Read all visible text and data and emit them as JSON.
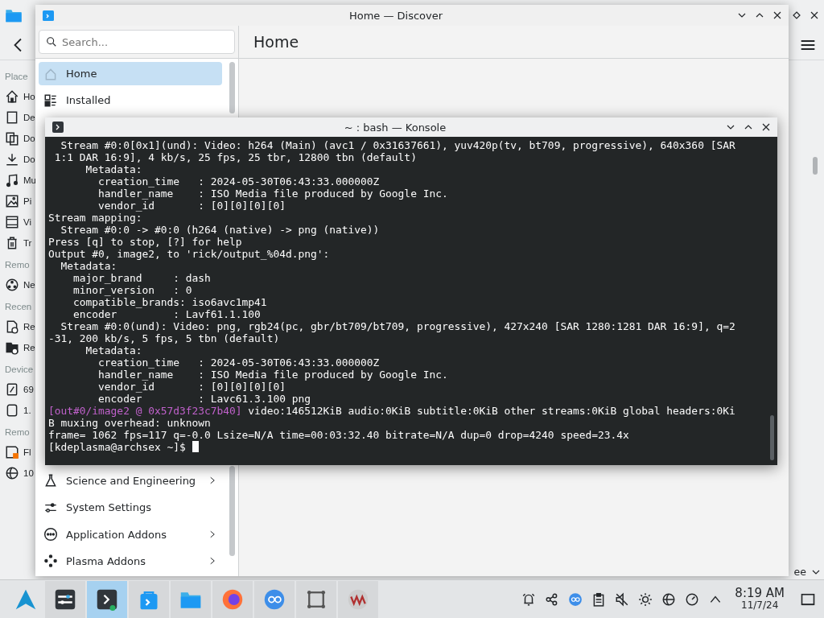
{
  "file_manager": {
    "places": [
      {
        "kind": "header",
        "label": "Place"
      },
      {
        "kind": "item",
        "label": "Ho"
      },
      {
        "kind": "item",
        "label": "De"
      },
      {
        "kind": "item",
        "label": "Do"
      },
      {
        "kind": "item",
        "label": "Do"
      },
      {
        "kind": "item",
        "label": "Mu"
      },
      {
        "kind": "item",
        "label": "Pi"
      },
      {
        "kind": "item",
        "label": "Vi"
      },
      {
        "kind": "item",
        "label": "Tr"
      },
      {
        "kind": "header",
        "label": "Remo"
      },
      {
        "kind": "item",
        "label": "Ne"
      },
      {
        "kind": "header",
        "label": "Recen"
      },
      {
        "kind": "item",
        "label": "Re"
      },
      {
        "kind": "item",
        "label": "Re"
      },
      {
        "kind": "header",
        "label": "Device"
      },
      {
        "kind": "item",
        "label": "69"
      },
      {
        "kind": "item",
        "label": "1."
      },
      {
        "kind": "header",
        "label": "Remo"
      },
      {
        "kind": "item",
        "label": "Fl"
      },
      {
        "kind": "item",
        "label": "10"
      }
    ],
    "footer_text": "ee"
  },
  "discover": {
    "window": {
      "title": "Home — Discover"
    },
    "search": {
      "placeholder": "Search..."
    },
    "heading": "Home",
    "sidebar": {
      "items": [
        {
          "label": "Home",
          "selected": true,
          "has_children": false
        },
        {
          "label": "Installed",
          "selected": false,
          "has_children": false
        }
      ],
      "lower_items": [
        {
          "label": "Science and Engineering",
          "selected": false,
          "has_children": true
        },
        {
          "label": "System Settings",
          "selected": false,
          "has_children": false
        },
        {
          "label": "Application Addons",
          "selected": false,
          "has_children": true
        },
        {
          "label": "Plasma Addons",
          "selected": false,
          "has_children": true
        }
      ]
    }
  },
  "terminal": {
    "window": {
      "title": "~ : bash — Konsole"
    },
    "lines": [
      {
        "text": "  Stream #0:0[0x1](und): Video: h264 (Main) (avc1 / 0x31637661), yuv420p(tv, bt709, progressive), 640x360 [SAR"
      },
      {
        "text": " 1:1 DAR 16:9], 4 kb/s, 25 fps, 25 tbr, 12800 tbn (default)"
      },
      {
        "text": "      Metadata:"
      },
      {
        "text": "        creation_time   : 2024-05-30T06:43:33.000000Z"
      },
      {
        "text": "        handler_name    : ISO Media file produced by Google Inc."
      },
      {
        "text": "        vendor_id       : [0][0][0][0]"
      },
      {
        "text": "Stream mapping:"
      },
      {
        "text": "  Stream #0:0 -> #0:0 (h264 (native) -> png (native))"
      },
      {
        "text": "Press [q] to stop, [?] for help"
      },
      {
        "text": "Output #0, image2, to 'rick/output_%04d.png':"
      },
      {
        "text": "  Metadata:"
      },
      {
        "text": "    major_brand     : dash"
      },
      {
        "text": "    minor_version   : 0"
      },
      {
        "text": "    compatible_brands: iso6avc1mp41"
      },
      {
        "text": "    encoder         : Lavf61.1.100"
      },
      {
        "text": "  Stream #0:0(und): Video: png, rgb24(pc, gbr/bt709/bt709, progressive), 427x240 [SAR 1280:1281 DAR 16:9], q=2"
      },
      {
        "text": "-31, 200 kb/s, 5 fps, 5 tbn (default)"
      },
      {
        "text": "      Metadata:"
      },
      {
        "text": "        creation_time   : 2024-05-30T06:43:33.000000Z"
      },
      {
        "text": "        handler_name    : ISO Media file produced by Google Inc."
      },
      {
        "text": "        vendor_id       : [0][0][0][0]"
      },
      {
        "text": "        encoder         : Lavc61.3.100 png"
      },
      {
        "highlight": "[out#0/image2 @ 0x57d3f23c7b40]",
        "text": " video:146512KiB audio:0KiB subtitle:0KiB other streams:0KiB global headers:0Ki"
      },
      {
        "text": "B muxing overhead: unknown"
      },
      {
        "text": "frame= 1062 fps=117 q=-0.0 Lsize=N/A time=00:03:32.40 bitrate=N/A dup=0 drop=4240 speed=23.4x"
      },
      {
        "text": "[kdeplasma@archsex ~]$ ",
        "cursor": true
      }
    ]
  },
  "taskbar": {
    "tasks": [
      {
        "selected": false
      },
      {
        "selected": true
      },
      {
        "selected": false
      },
      {
        "selected": false
      },
      {
        "selected": false
      },
      {
        "selected": false
      },
      {
        "selected": false
      },
      {
        "selected": false
      }
    ],
    "clock": {
      "time": "8:19 AM",
      "date": "11/7/24"
    }
  }
}
